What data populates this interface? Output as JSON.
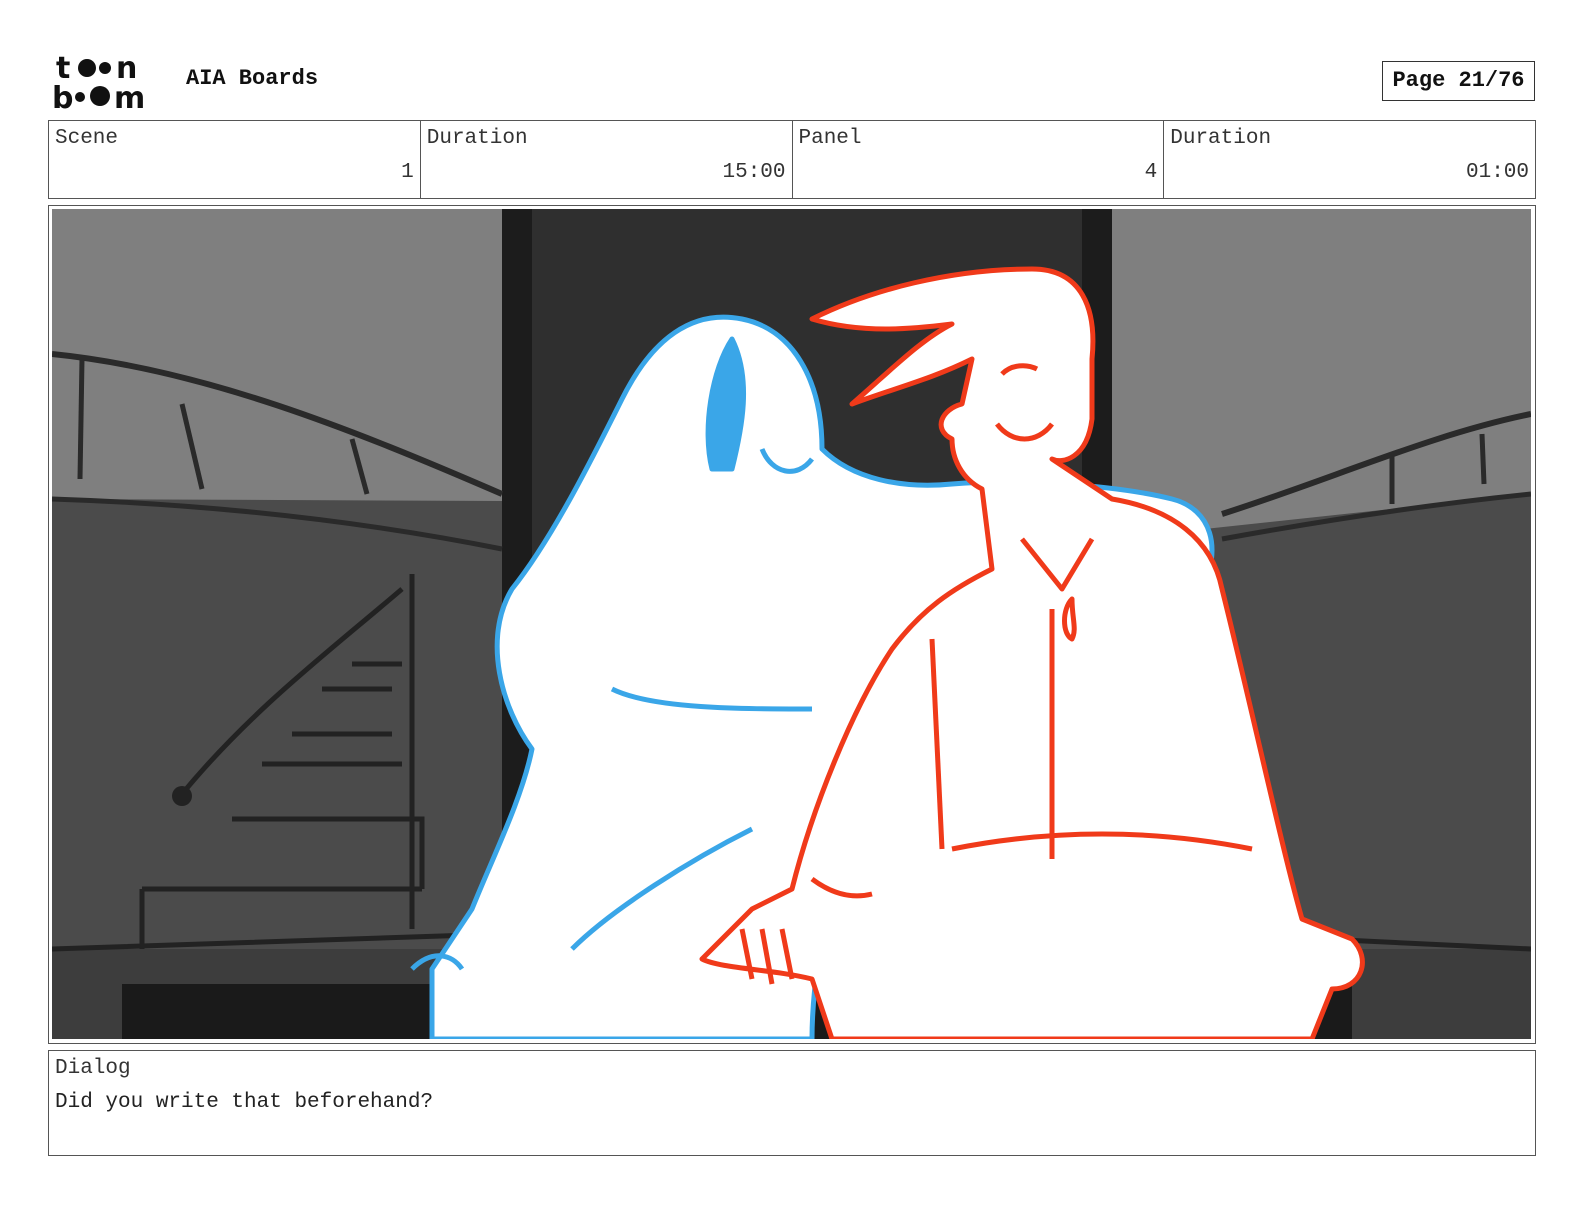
{
  "header": {
    "logo_text": "toon boom",
    "app_title": "AIA Boards",
    "page_label": "Page 21/76"
  },
  "info": {
    "scene_label": "Scene",
    "scene_value": "1",
    "scene_duration_label": "Duration",
    "scene_duration_value": "15:00",
    "panel_label": "Panel",
    "panel_value": "4",
    "panel_duration_label": "Duration",
    "panel_duration_value": "01:00"
  },
  "dialog": {
    "label": "Dialog",
    "text": "Did you write that beforehand?"
  },
  "colors": {
    "character_left": "#3aa6e8",
    "character_right": "#f03a1a",
    "bg_light": "#7f7f7f",
    "bg_mid": "#4a4a4a",
    "bg_dark": "#2e2e2e"
  }
}
